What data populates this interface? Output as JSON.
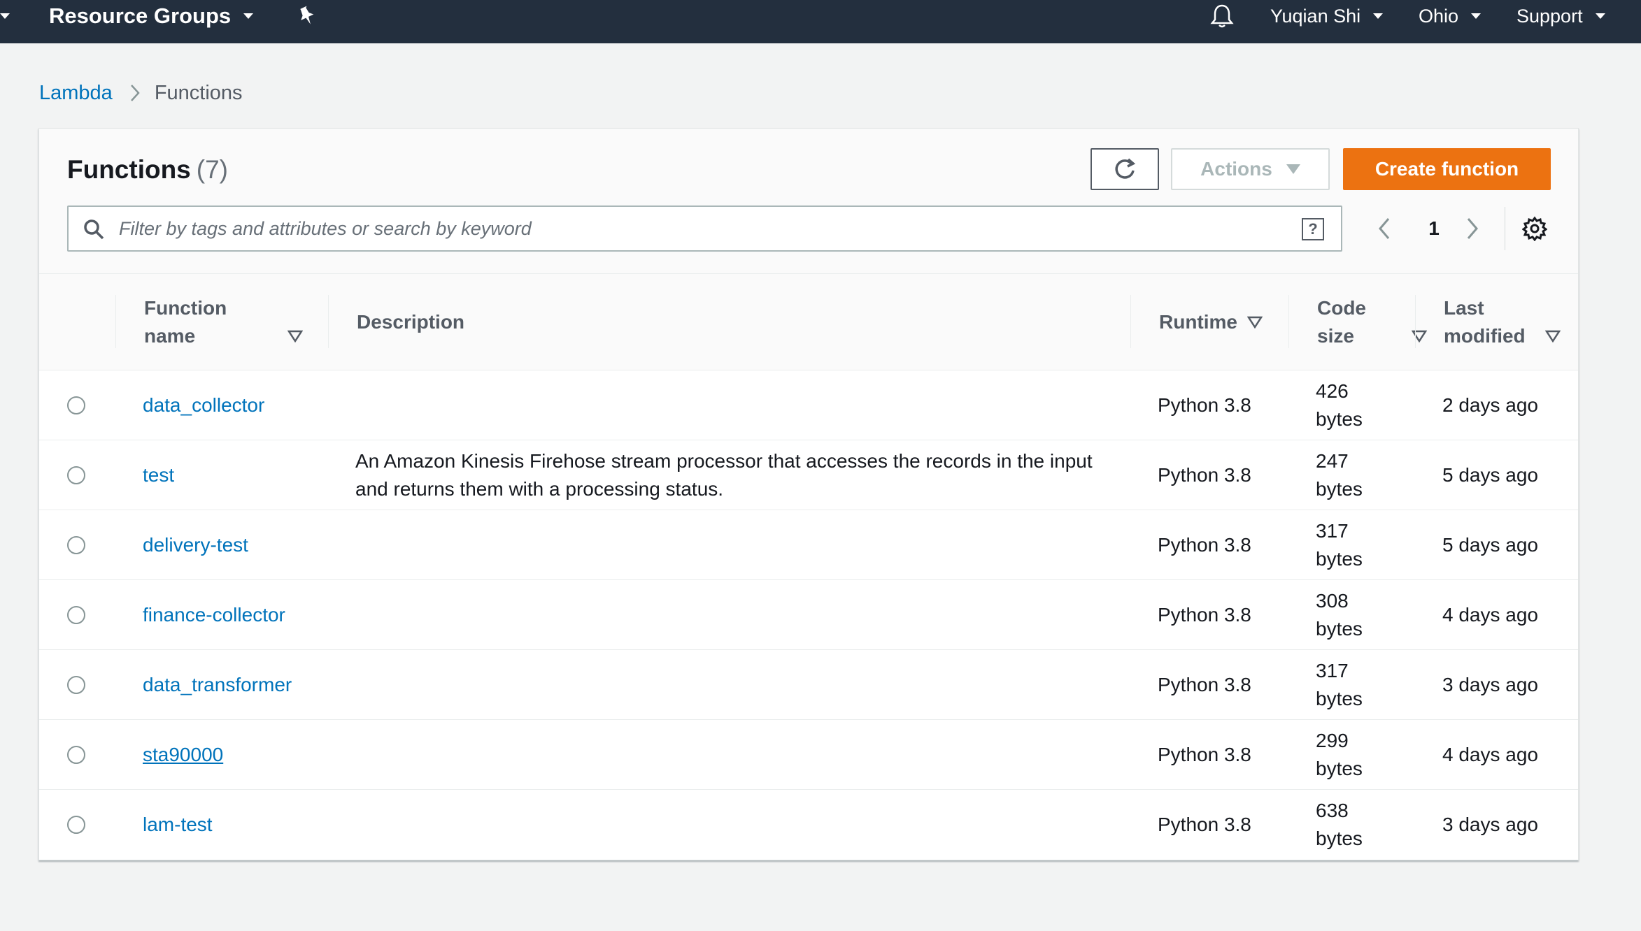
{
  "topnav": {
    "resource_groups": "Resource Groups",
    "user": "Yuqian Shi",
    "region": "Ohio",
    "support": "Support"
  },
  "breadcrumb": {
    "parent": "Lambda",
    "current": "Functions"
  },
  "panel": {
    "title": "Functions",
    "count": "(7)",
    "actions_label": "Actions",
    "create_label": "Create function",
    "search_placeholder": "Filter by tags and attributes or search by keyword",
    "help_glyph": "?",
    "page": "1"
  },
  "table": {
    "headers": {
      "function_name": [
        "Function",
        "name"
      ],
      "description": "Description",
      "runtime": "Runtime",
      "code_size": [
        "Code",
        "size"
      ],
      "last_modified": [
        "Last",
        "modified"
      ]
    },
    "rows": [
      {
        "name": "data_collector",
        "description": "",
        "runtime": "Python 3.8",
        "size_num": "426",
        "size_unit": "bytes",
        "modified": "2 days ago"
      },
      {
        "name": "test",
        "description": "An Amazon Kinesis Firehose stream processor that accesses the records in the input and returns them with a processing status.",
        "runtime": "Python 3.8",
        "size_num": "247",
        "size_unit": "bytes",
        "modified": "5 days ago"
      },
      {
        "name": "delivery-test",
        "description": "",
        "runtime": "Python 3.8",
        "size_num": "317",
        "size_unit": "bytes",
        "modified": "5 days ago"
      },
      {
        "name": "finance-collector",
        "description": "",
        "runtime": "Python 3.8",
        "size_num": "308",
        "size_unit": "bytes",
        "modified": "4 days ago"
      },
      {
        "name": "data_transformer",
        "description": "",
        "runtime": "Python 3.8",
        "size_num": "317",
        "size_unit": "bytes",
        "modified": "3 days ago"
      },
      {
        "name": "sta90000",
        "description": "",
        "runtime": "Python 3.8",
        "size_num": "299",
        "size_unit": "bytes",
        "modified": "4 days ago"
      },
      {
        "name": "lam-test",
        "description": "",
        "runtime": "Python 3.8",
        "size_num": "638",
        "size_unit": "bytes",
        "modified": "3 days ago"
      }
    ]
  },
  "colors": {
    "nav_bg": "#232f3e",
    "link": "#0073bb",
    "primary": "#ec7211",
    "page_bg": "#f2f3f3"
  }
}
